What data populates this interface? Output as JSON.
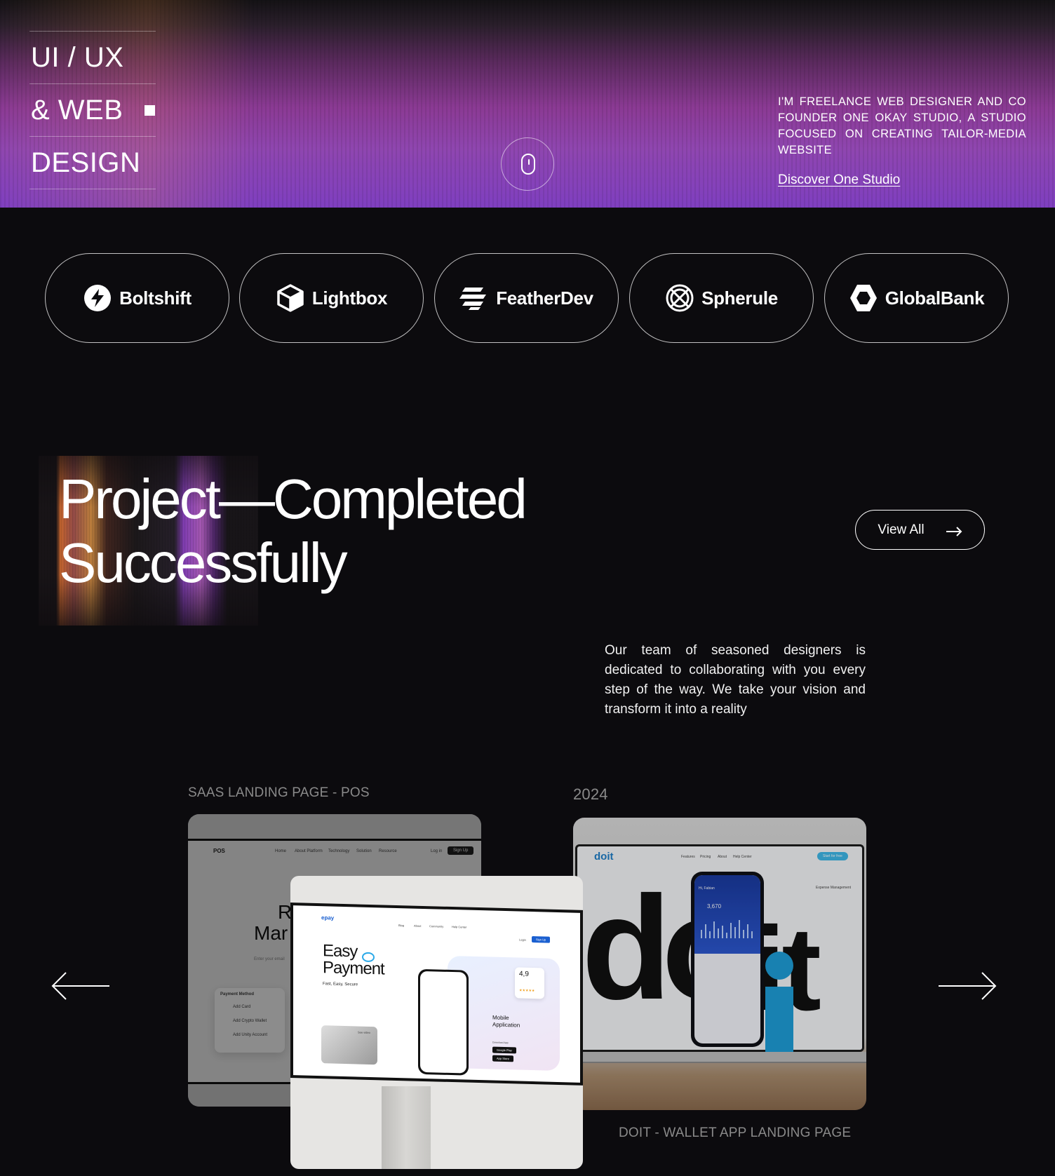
{
  "hero": {
    "title_line1": "UI / UX",
    "title_line2": "& WEB",
    "title_line3": "DESIGN",
    "description": "I'M FREELANCE WEB DESIGNER AND CO FOUNDER ONE OKAY STUDIO,  A STUDIO FOCUSED ON CREATING TAILOR-MEDIA WEBSITE",
    "link_label": "Discover One Studio"
  },
  "clients": [
    {
      "name": "Boltshift",
      "icon": "bolt-icon"
    },
    {
      "name": "Lightbox",
      "icon": "cube-icon"
    },
    {
      "name": "FeatherDev",
      "icon": "feather-icon"
    },
    {
      "name": "Spherule",
      "icon": "sphere-icon"
    },
    {
      "name": "GlobalBank",
      "icon": "hexagon-icon"
    }
  ],
  "projects": {
    "title_line1": "Project—Completed",
    "title_line2": "Successfully",
    "view_all_label": "View All",
    "description": "Our team of seasoned designers is dedicated to collaborating with you every step of the way. We take your vision and transform it into a reality",
    "items": [
      {
        "caption": "SAAS LANDING PAGE - POS"
      },
      {
        "caption": "2024"
      },
      {
        "caption": "DOIT - WALLET APP LANDING PAGE"
      }
    ]
  },
  "mockups": {
    "pos": {
      "brand": "POS",
      "nav": [
        "Home",
        "About Platform",
        "Technology",
        "Solution",
        "Resource"
      ],
      "login": "Log in",
      "signup": "Sign Up",
      "headline_part1": "R",
      "headline_part2": "Mar",
      "panel_title": "Payment Method",
      "panel_items": [
        "Add Card",
        "Add Crypto Wallet",
        "Add Unity Account"
      ],
      "input_placeholder": "Enter your email"
    },
    "epay": {
      "brand": "epay",
      "nav": [
        "Blog",
        "About",
        "Community",
        "Help Center"
      ],
      "login": "Login",
      "signup": "Sign Up",
      "headline1": "Easy",
      "headline2": "Payment",
      "tagline": "Fast, Easy, Secure",
      "rating": "4,9",
      "mobile_label1": "Mobile",
      "mobile_label2": "Application",
      "download_label": "Download App",
      "store1": "Google Play",
      "store2": "App Store",
      "see_video": "See video"
    },
    "doit": {
      "brand": "doit",
      "nav": [
        "Features",
        "Pricing",
        "About",
        "Help Center"
      ],
      "cta": "Start for free",
      "balance": "3,670",
      "greeting": "Hi, Fabian",
      "big_word1": "do",
      "big_word2": "it",
      "side_title": "Expense Management"
    }
  },
  "colors": {
    "page_bg": "#0c0b0e",
    "hero_purple": "#8f46b0",
    "accent_orange": "#f07a36",
    "doit_blue": "#1e7ec8",
    "epay_blue": "#1a5fd0"
  }
}
